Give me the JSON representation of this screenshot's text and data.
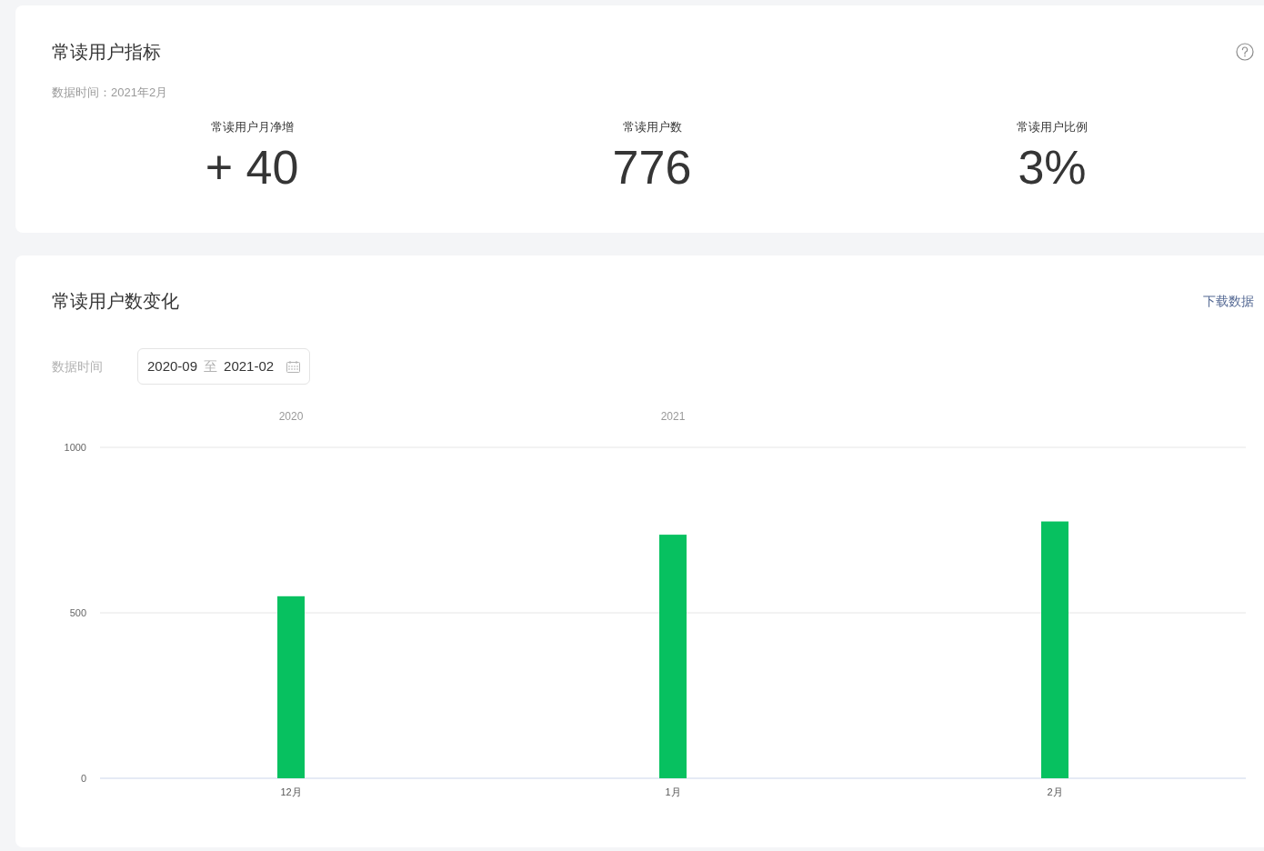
{
  "metrics_card": {
    "title": "常读用户指标",
    "data_time": "数据时间：2021年2月",
    "metrics": [
      {
        "label": "常读用户月净增",
        "value": "+ 40"
      },
      {
        "label": "常读用户数",
        "value": "776"
      },
      {
        "label": "常读用户比例",
        "value": "3%"
      }
    ]
  },
  "trend_card": {
    "title": "常读用户数变化",
    "download_link": "下载数据",
    "date_filter": {
      "label": "数据时间",
      "start": "2020-09",
      "separator": "至",
      "end": "2021-02"
    },
    "chart_data": {
      "type": "bar",
      "categories": [
        "12月",
        "1月",
        "2月"
      ],
      "series": [
        {
          "color": "#07c160",
          "values": [
            550,
            736,
            776
          ]
        }
      ],
      "ylim": [
        0,
        1000
      ],
      "yticks": [
        0,
        500,
        1000
      ],
      "annotations": [
        "2020",
        "2021"
      ]
    }
  }
}
